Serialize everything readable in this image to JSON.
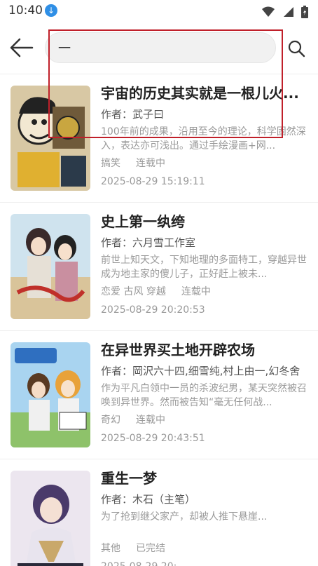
{
  "status_bar": {
    "time": "10:40",
    "download_icon": "download-icon",
    "icons": [
      "wifi-icon",
      "signal-icon",
      "battery-icon"
    ]
  },
  "search": {
    "value": "一",
    "back_icon": "arrow-left-icon",
    "search_icon": "search-icon"
  },
  "results": [
    {
      "title": "宇宙的历史其实就是一根儿火...",
      "author": "作者：武子曰",
      "desc": "100年前的成果，沿用至今的理论，科学固然深入，表达亦可浅出。通过手绘漫画+网...",
      "tags": "搞笑",
      "status": "连载中",
      "time": "2025-08-29 15:19:11"
    },
    {
      "title": "史上第一纨绔",
      "author": "作者：六月雪工作室",
      "desc": "前世上知天文，下知地理的多面特工，穿越异世成为地主家的傻儿子，正好赶上被未...",
      "tags": "恋爱 古风 穿越",
      "status": "连载中",
      "time": "2025-08-29 20:20:53"
    },
    {
      "title": "在异世界买土地开辟农场",
      "author": "作者：岡沢六十四,细雪纯,村上由一,幻冬舍",
      "desc": "作为平凡白领中一员的杀波纪男，某天突然被召唤到异世界。然而被告知“毫无任何战...",
      "tags": "奇幻",
      "status": "连载中",
      "time": "2025-08-29 20:43:51"
    },
    {
      "title": "重生一梦",
      "author": "作者：木石（主笔）",
      "desc": "为了抢到继父家产，却被人推下悬崖...",
      "tags": "其他",
      "status": "已完结",
      "time": "2025-08-29 20:"
    }
  ],
  "colors": {
    "accent": "#c0202a",
    "search_bg": "#f1f1f1",
    "meta_text": "#999999"
  }
}
